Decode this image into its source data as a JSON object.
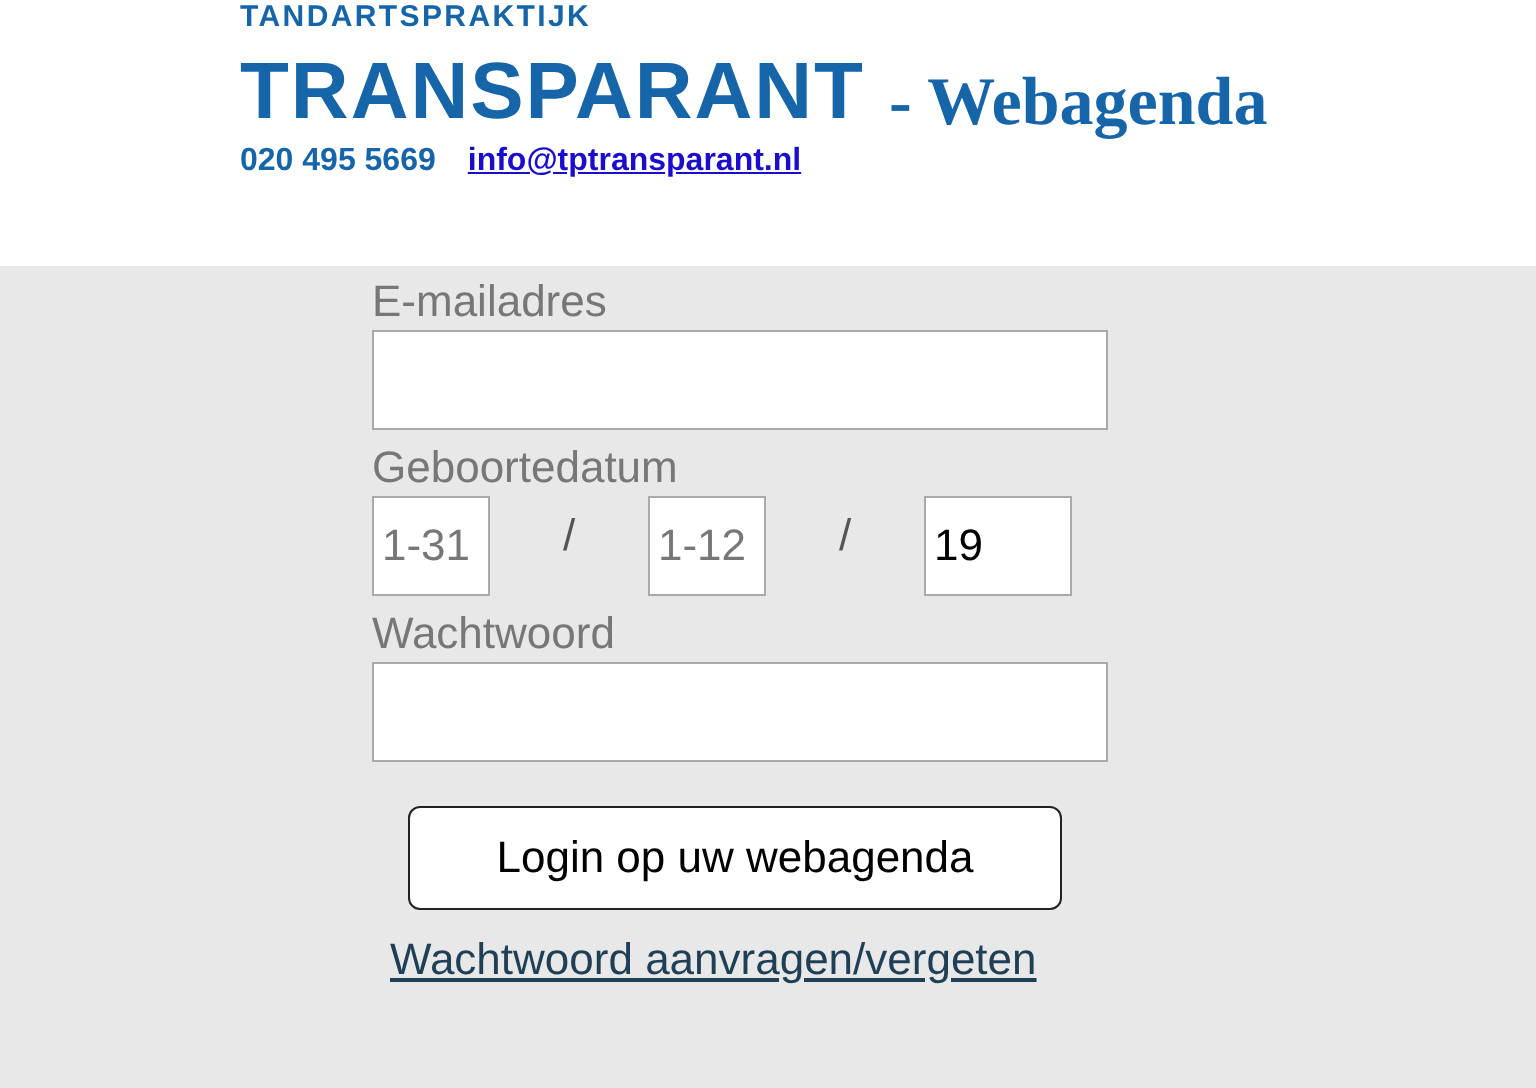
{
  "header": {
    "tagline": "TANDARTSPRAKTIJK",
    "logo": "TRANSPARANT",
    "title": "- Webagenda",
    "phone": "020 495 5669",
    "email": "info@tptransparant.nl"
  },
  "form": {
    "email_label": "E-mailadres",
    "birthdate_label": "Geboortedatum",
    "birthdate": [
      {
        "kind": "day",
        "placeholder": "1-31"
      },
      {
        "kind": "separator",
        "separator": "/"
      },
      {
        "kind": "month",
        "placeholder": "1-12"
      },
      {
        "kind": "separator",
        "separator": "/"
      },
      {
        "kind": "year",
        "value": "19"
      }
    ],
    "password_label": "Wachtwoord",
    "login_button": "Login op uw webagenda",
    "forgot_link": "Wachtwoord aanvragen/vergeten"
  }
}
